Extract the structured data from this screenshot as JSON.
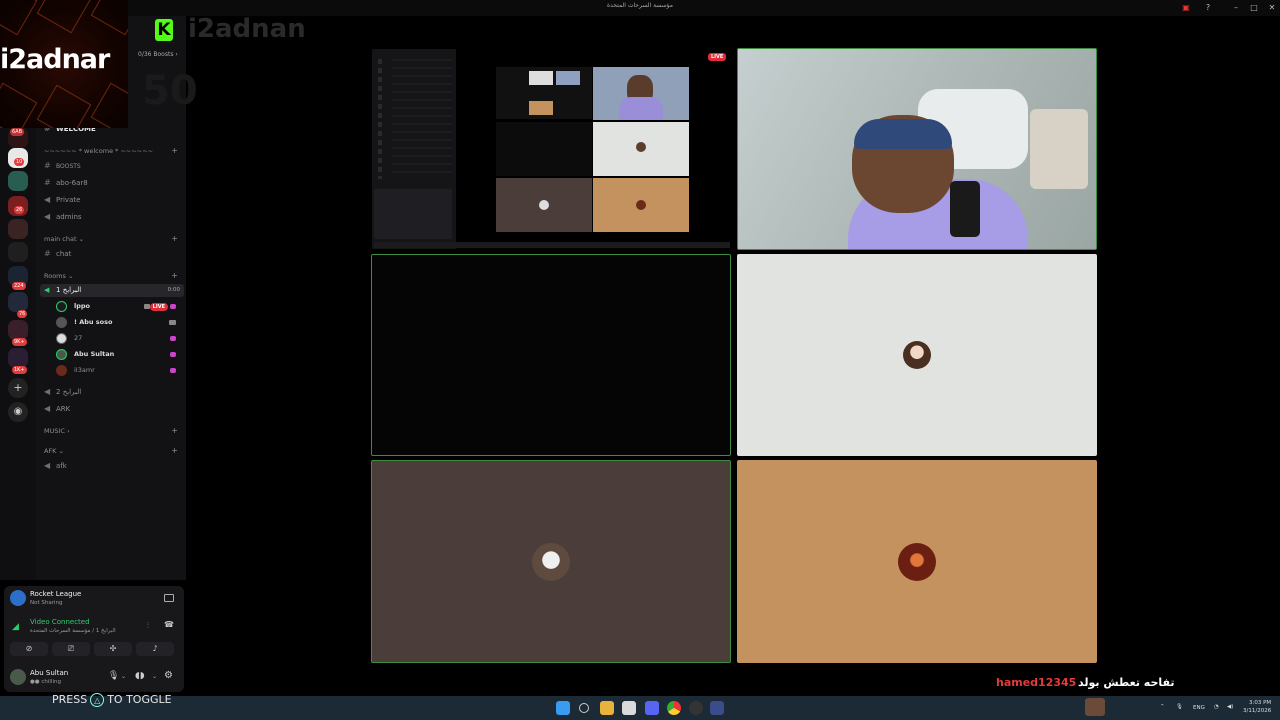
{
  "window": {
    "title": "مؤسسة السرحات المتحدة"
  },
  "logo": {
    "text": "i2adnar"
  },
  "watermark": {
    "name": "i2adnan",
    "number": "50"
  },
  "kick": {
    "letter": "K"
  },
  "server": {
    "boosts": "0/36 Boosts",
    "boosts_chevron": "›"
  },
  "server_badges": [
    "6AB",
    "10",
    "26",
    "224",
    "76",
    "9K+",
    "1K+"
  ],
  "channels": {
    "welcome": "WELCOME",
    "welcome_category": "~~~~~~ * welcome * ~~~~~~",
    "boosts": "BOOSTS",
    "abo_6ar8": "abo-6ar8",
    "private": "Private",
    "admins": "admins",
    "main_chat_category": "main chat",
    "chat": "chat",
    "rooms_category": "Rooms",
    "room1": "البرابخ 1",
    "room1_timer": "0:00",
    "room2": "البرابخ 2",
    "ark": "ARK",
    "music_category": "MUSIC",
    "afk_category": "AFK",
    "afk": "afk"
  },
  "members": [
    {
      "name": "lppo",
      "live": "LIVE"
    },
    {
      "name": "! Abu soso"
    },
    {
      "name": "27"
    },
    {
      "name": "Abu Sultan"
    },
    {
      "name": "iI3amr"
    }
  ],
  "activity": {
    "game": "Rocket League",
    "status": "Not Sharing"
  },
  "connection": {
    "status": "Video Connected",
    "channel": "البرابخ 1 / مؤسسة السرحات المتحدة"
  },
  "user": {
    "name": "Abu Sultan",
    "status": "chilling"
  },
  "overlay": {
    "press": "PRESS",
    "toggle": "TO TOGGLE",
    "live": "LIVE"
  },
  "chat": {
    "user": "hamed12345",
    "message": "تفاحه تعطش بولد"
  },
  "tray": {
    "lang": "ENG",
    "time": "3:03 PM",
    "date": "3/11/2026"
  },
  "colors": {
    "accent": "#3d8c40",
    "live": "#e02d3c",
    "kick": "#53fc18",
    "tile_white": "#e0e3df",
    "tile_brown": "#4a3d3a",
    "tile_tan": "#c4925e"
  }
}
